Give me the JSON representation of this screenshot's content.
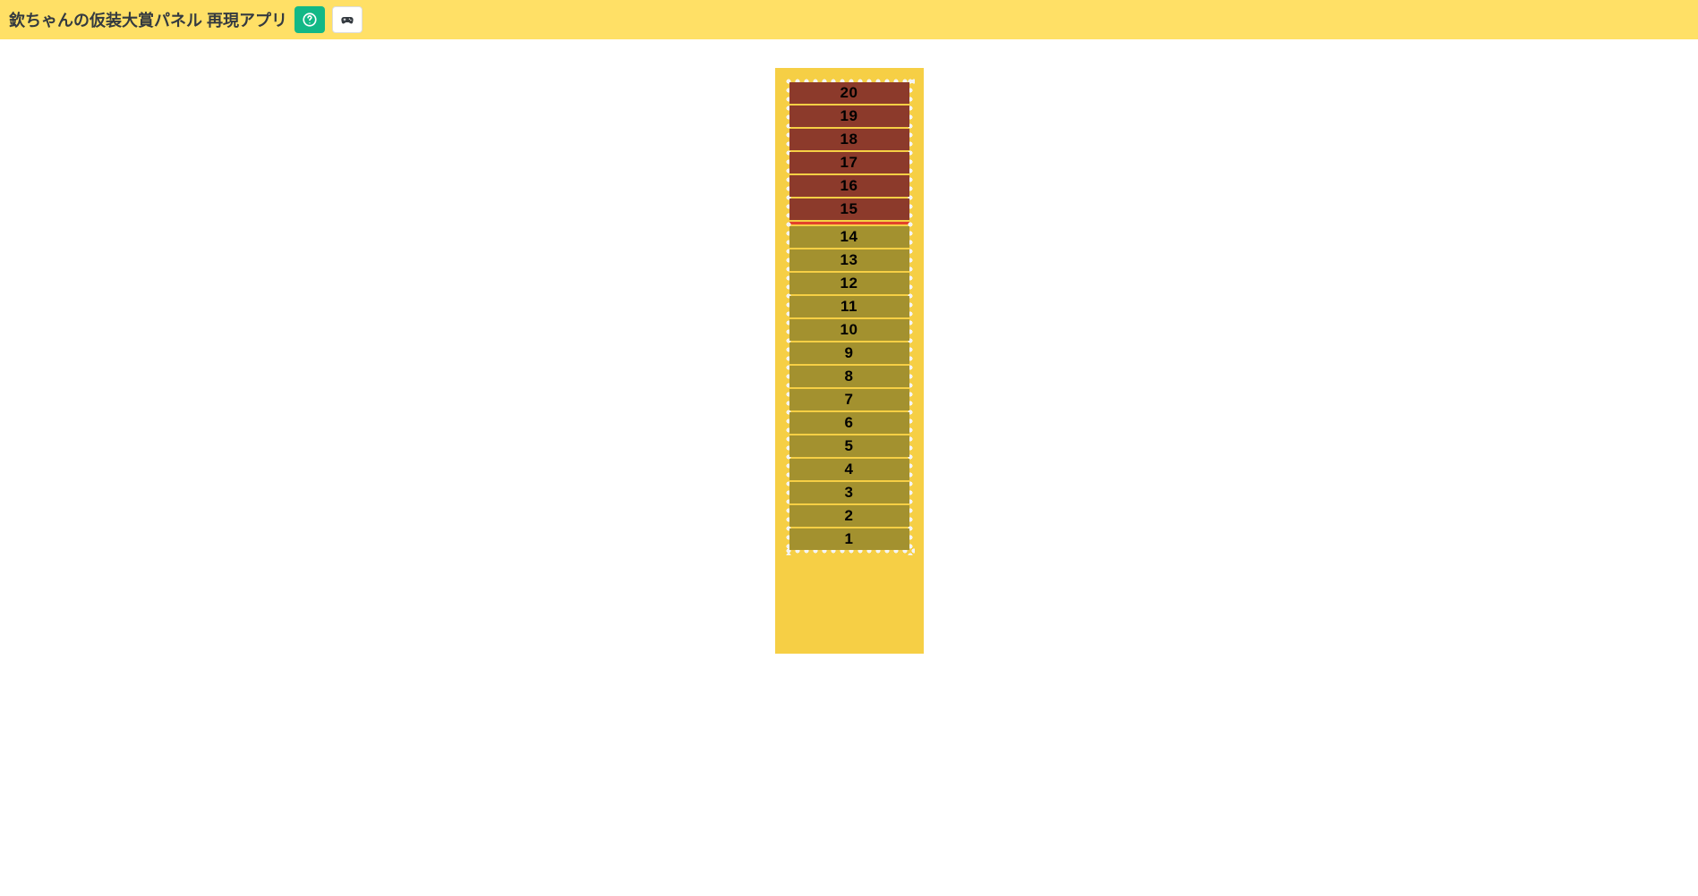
{
  "header": {
    "title": "欽ちゃんの仮装大賞パネル 再現アプリ"
  },
  "panel": {
    "max": 20,
    "threshold": 15,
    "segments": [
      {
        "n": 20,
        "zone": "high"
      },
      {
        "n": 19,
        "zone": "high"
      },
      {
        "n": 18,
        "zone": "high"
      },
      {
        "n": 17,
        "zone": "high"
      },
      {
        "n": 16,
        "zone": "high"
      },
      {
        "n": 15,
        "zone": "high"
      },
      {
        "n": 14,
        "zone": "low"
      },
      {
        "n": 13,
        "zone": "low"
      },
      {
        "n": 12,
        "zone": "low"
      },
      {
        "n": 11,
        "zone": "low"
      },
      {
        "n": 10,
        "zone": "low"
      },
      {
        "n": 9,
        "zone": "low"
      },
      {
        "n": 8,
        "zone": "low"
      },
      {
        "n": 7,
        "zone": "low"
      },
      {
        "n": 6,
        "zone": "low"
      },
      {
        "n": 5,
        "zone": "low"
      },
      {
        "n": 4,
        "zone": "low"
      },
      {
        "n": 3,
        "zone": "low"
      },
      {
        "n": 2,
        "zone": "low"
      },
      {
        "n": 1,
        "zone": "low"
      }
    ]
  },
  "colors": {
    "header_bg": "#ffe066",
    "board_bg": "#f6cf45",
    "high_bg": "#8c3a2b",
    "low_bg": "#a3912f",
    "threshold": "#e3422b",
    "help_btn": "#12b886"
  }
}
